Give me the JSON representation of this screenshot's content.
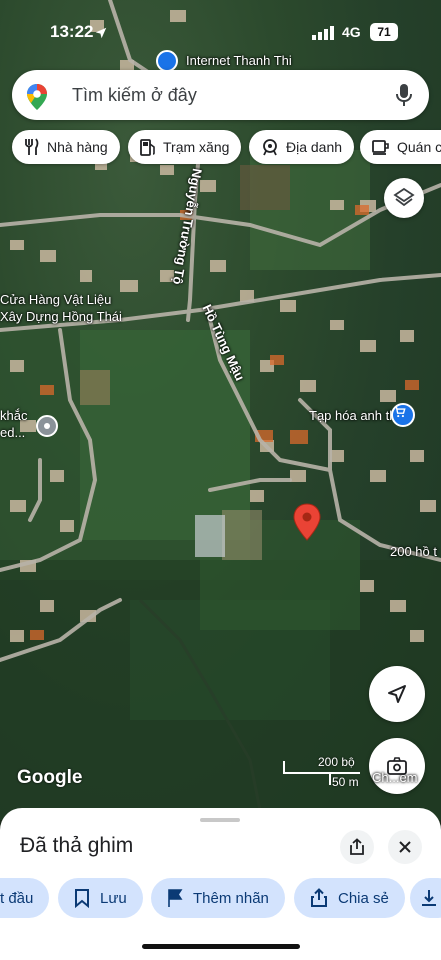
{
  "status_bar": {
    "time": "13:22",
    "network": "4G",
    "battery": "71"
  },
  "search": {
    "placeholder": "Tìm kiếm ở đây"
  },
  "chips": [
    {
      "label": "Nhà hàng",
      "icon": "fork-knife-icon"
    },
    {
      "label": "Trạm xăng",
      "icon": "gas-pump-icon"
    },
    {
      "label": "Địa danh",
      "icon": "landmark-icon"
    },
    {
      "label": "Quán ca",
      "icon": "cafe-icon"
    }
  ],
  "map_labels": {
    "poi_top": "Internet Thanh Thi",
    "store_line1": "Cửa Hàng Vật Liệu",
    "store_line2": "Xây Dựng Hồng Thái",
    "road_nguyen": "Nguyễn Trường Tộ",
    "road_ho": "Hồ Tùng Mậu",
    "grocery": "Tạp hóa anh thư",
    "left_line1": "khắc",
    "left_line2": "ed...",
    "address_fragment": "200 hồ t",
    "layers_icon": "layers-icon",
    "pin_color": "#ea4335"
  },
  "map_controls": {
    "streetview_label": "Ch...em"
  },
  "attribution": "Google",
  "scale": {
    "imperial": "200 bộ",
    "metric": "50 m"
  },
  "sheet": {
    "title": "Đã thả ghim",
    "actions": [
      {
        "label": "t đầu",
        "icon": "navigation-icon"
      },
      {
        "label": "Lưu",
        "icon": "bookmark-icon"
      },
      {
        "label": "Thêm nhãn",
        "icon": "flag-icon"
      },
      {
        "label": "Chia sẻ",
        "icon": "share-icon"
      },
      {
        "label": "",
        "icon": "download-icon"
      }
    ]
  },
  "colors": {
    "accent": "#1a73e8",
    "chip_bg": "#ffffff",
    "action_bg": "#d3e3fd",
    "pin": "#ea4335"
  }
}
